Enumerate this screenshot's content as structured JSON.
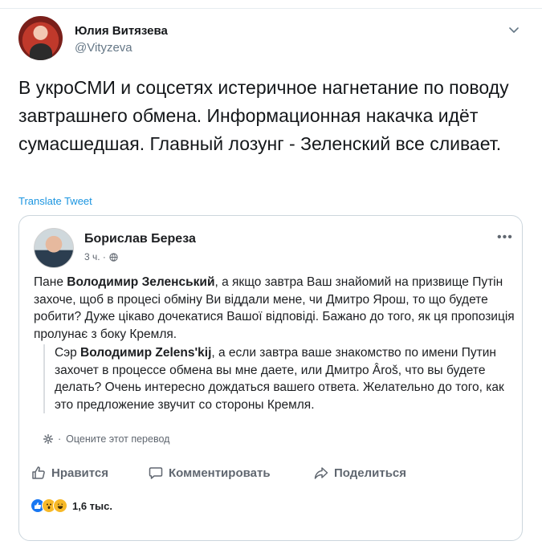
{
  "tweet": {
    "author_name": "Юлия Витязева",
    "author_handle": "@Vityzeva",
    "text": "В укроСМИ и соцсетях истеричное нагнетание по поводу завтрашнего обмена. Информационная накачка идёт сумасшедшая. Главный лозунг - Зеленский все сливает.",
    "translate_label": "Translate Tweet"
  },
  "quote": {
    "author_name": "Борислав Береза",
    "time": "3 ч. ·",
    "more_label": "•••",
    "ua_text_1": "Пане ",
    "ua_bold": "Володимир Зеленський",
    "ua_text_2": ", а якщо завтра Ваш знайомий на призвище Путін захоче, щоб в процесі обміну Ви віддали мене, чи Дмитро Ярош, то що будете робити? Дуже цікаво дочекатися Вашої відповіді. Бажано до того, як ця пропозиція пролунає з боку Кремля.",
    "ru_text_1": "Сэр ",
    "ru_bold": "Володимир Zelens'kij",
    "ru_text_2": ", а если завтра ваше знакомство по имени Путин захочет в процессе обмена вы мне даете, или Дмитро Ârоš, что вы будете делать? Очень интересно дождаться вашего ответа. Желательно до того, как это предложение звучит со стороны Кремля.",
    "rate_label": "Оцените этот перевод",
    "rate_sep": "·",
    "actions": {
      "like": "Нравится",
      "comment": "Комментировать",
      "share": "Поделиться"
    },
    "reactions_count": "1,6 тыс."
  },
  "icons": {
    "caret": "chevron-down-icon",
    "globe": "globe-icon",
    "gear": "gear-icon",
    "like": "thumbs-up-icon",
    "comment": "comment-icon",
    "share": "share-icon"
  },
  "colors": {
    "link": "#1b95e0",
    "fb_blue": "#1877f2",
    "muted": "#657786"
  }
}
